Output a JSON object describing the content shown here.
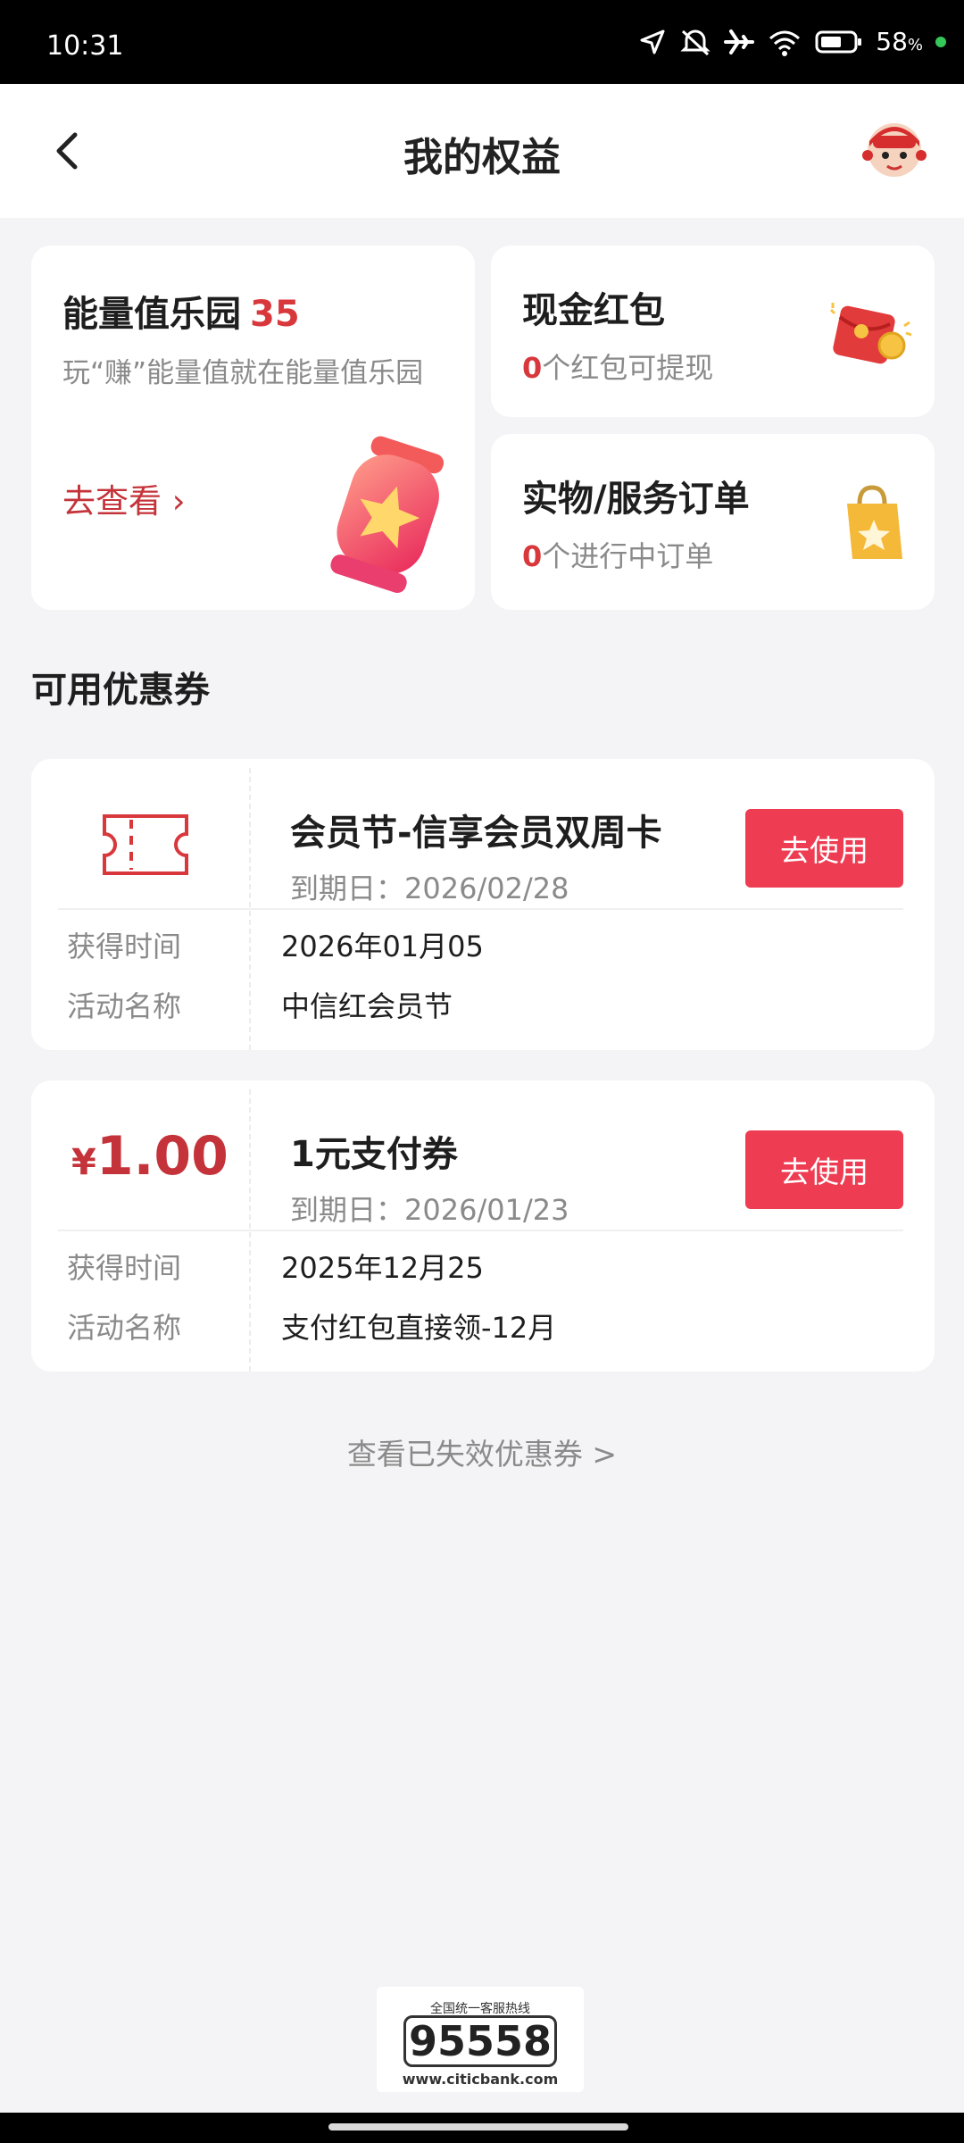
{
  "status_bar": {
    "time": "10:31",
    "battery_percent": "58",
    "battery_unit": "%",
    "icons": [
      "location-icon",
      "mute-icon",
      "airplane-icon",
      "wifi-icon",
      "battery-icon"
    ]
  },
  "header": {
    "title": "我的权益",
    "back_icon": "chevron-left-icon",
    "avatar_icon": "mascot-avatar-icon"
  },
  "energy_card": {
    "title": "能量值乐园",
    "value": "35",
    "description": "玩“赚”能量值就在能量值乐园",
    "link_label": "去查看",
    "link_arrow": "›"
  },
  "cash_card": {
    "title": "现金红包",
    "count": "0",
    "suffix": "个红包可提现"
  },
  "orders_card": {
    "title": "实物/服务订单",
    "count": "0",
    "suffix": "个进行中订单"
  },
  "section_title": "可用优惠券",
  "coupons": [
    {
      "name": "会员节-信享会员双周卡",
      "expiry": "到期日：2026/02/28",
      "button": "去使用",
      "obtained_label": "获得时间",
      "obtained_value": "2026年01月05",
      "activity_label": "活动名称",
      "activity_value": "中信红会员节"
    },
    {
      "currency": "¥",
      "amount": "1.00",
      "name": "1元支付券",
      "expiry": "到期日：2026/01/23",
      "button": "去使用",
      "obtained_label": "获得时间",
      "obtained_value": "2025年12月25",
      "activity_label": "活动名称",
      "activity_value": "支付红包直接领-12月"
    }
  ],
  "expired_link": "查看已失效优惠券 >",
  "hotline": {
    "caption": "全国统一客服热线",
    "number": "95558",
    "url": "www.citicbank.com"
  },
  "colors": {
    "accent_red": "#d8383c",
    "button_red": "#ee3d52",
    "page_bg": "#f4f4f6"
  }
}
